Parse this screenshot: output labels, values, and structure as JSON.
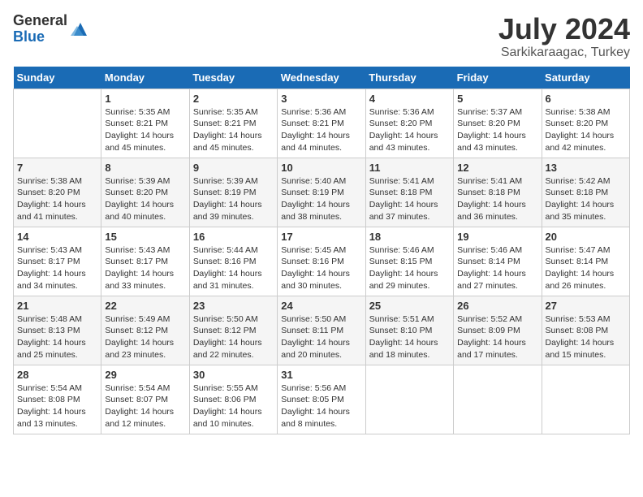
{
  "header": {
    "logo_general": "General",
    "logo_blue": "Blue",
    "month_year": "July 2024",
    "location": "Sarkikaraagac, Turkey"
  },
  "days_of_week": [
    "Sunday",
    "Monday",
    "Tuesday",
    "Wednesday",
    "Thursday",
    "Friday",
    "Saturday"
  ],
  "weeks": [
    [
      {
        "day": "",
        "info": ""
      },
      {
        "day": "1",
        "info": "Sunrise: 5:35 AM\nSunset: 8:21 PM\nDaylight: 14 hours\nand 45 minutes."
      },
      {
        "day": "2",
        "info": "Sunrise: 5:35 AM\nSunset: 8:21 PM\nDaylight: 14 hours\nand 45 minutes."
      },
      {
        "day": "3",
        "info": "Sunrise: 5:36 AM\nSunset: 8:21 PM\nDaylight: 14 hours\nand 44 minutes."
      },
      {
        "day": "4",
        "info": "Sunrise: 5:36 AM\nSunset: 8:20 PM\nDaylight: 14 hours\nand 43 minutes."
      },
      {
        "day": "5",
        "info": "Sunrise: 5:37 AM\nSunset: 8:20 PM\nDaylight: 14 hours\nand 43 minutes."
      },
      {
        "day": "6",
        "info": "Sunrise: 5:38 AM\nSunset: 8:20 PM\nDaylight: 14 hours\nand 42 minutes."
      }
    ],
    [
      {
        "day": "7",
        "info": "Sunrise: 5:38 AM\nSunset: 8:20 PM\nDaylight: 14 hours\nand 41 minutes."
      },
      {
        "day": "8",
        "info": "Sunrise: 5:39 AM\nSunset: 8:20 PM\nDaylight: 14 hours\nand 40 minutes."
      },
      {
        "day": "9",
        "info": "Sunrise: 5:39 AM\nSunset: 8:19 PM\nDaylight: 14 hours\nand 39 minutes."
      },
      {
        "day": "10",
        "info": "Sunrise: 5:40 AM\nSunset: 8:19 PM\nDaylight: 14 hours\nand 38 minutes."
      },
      {
        "day": "11",
        "info": "Sunrise: 5:41 AM\nSunset: 8:18 PM\nDaylight: 14 hours\nand 37 minutes."
      },
      {
        "day": "12",
        "info": "Sunrise: 5:41 AM\nSunset: 8:18 PM\nDaylight: 14 hours\nand 36 minutes."
      },
      {
        "day": "13",
        "info": "Sunrise: 5:42 AM\nSunset: 8:18 PM\nDaylight: 14 hours\nand 35 minutes."
      }
    ],
    [
      {
        "day": "14",
        "info": "Sunrise: 5:43 AM\nSunset: 8:17 PM\nDaylight: 14 hours\nand 34 minutes."
      },
      {
        "day": "15",
        "info": "Sunrise: 5:43 AM\nSunset: 8:17 PM\nDaylight: 14 hours\nand 33 minutes."
      },
      {
        "day": "16",
        "info": "Sunrise: 5:44 AM\nSunset: 8:16 PM\nDaylight: 14 hours\nand 31 minutes."
      },
      {
        "day": "17",
        "info": "Sunrise: 5:45 AM\nSunset: 8:16 PM\nDaylight: 14 hours\nand 30 minutes."
      },
      {
        "day": "18",
        "info": "Sunrise: 5:46 AM\nSunset: 8:15 PM\nDaylight: 14 hours\nand 29 minutes."
      },
      {
        "day": "19",
        "info": "Sunrise: 5:46 AM\nSunset: 8:14 PM\nDaylight: 14 hours\nand 27 minutes."
      },
      {
        "day": "20",
        "info": "Sunrise: 5:47 AM\nSunset: 8:14 PM\nDaylight: 14 hours\nand 26 minutes."
      }
    ],
    [
      {
        "day": "21",
        "info": "Sunrise: 5:48 AM\nSunset: 8:13 PM\nDaylight: 14 hours\nand 25 minutes."
      },
      {
        "day": "22",
        "info": "Sunrise: 5:49 AM\nSunset: 8:12 PM\nDaylight: 14 hours\nand 23 minutes."
      },
      {
        "day": "23",
        "info": "Sunrise: 5:50 AM\nSunset: 8:12 PM\nDaylight: 14 hours\nand 22 minutes."
      },
      {
        "day": "24",
        "info": "Sunrise: 5:50 AM\nSunset: 8:11 PM\nDaylight: 14 hours\nand 20 minutes."
      },
      {
        "day": "25",
        "info": "Sunrise: 5:51 AM\nSunset: 8:10 PM\nDaylight: 14 hours\nand 18 minutes."
      },
      {
        "day": "26",
        "info": "Sunrise: 5:52 AM\nSunset: 8:09 PM\nDaylight: 14 hours\nand 17 minutes."
      },
      {
        "day": "27",
        "info": "Sunrise: 5:53 AM\nSunset: 8:08 PM\nDaylight: 14 hours\nand 15 minutes."
      }
    ],
    [
      {
        "day": "28",
        "info": "Sunrise: 5:54 AM\nSunset: 8:08 PM\nDaylight: 14 hours\nand 13 minutes."
      },
      {
        "day": "29",
        "info": "Sunrise: 5:54 AM\nSunset: 8:07 PM\nDaylight: 14 hours\nand 12 minutes."
      },
      {
        "day": "30",
        "info": "Sunrise: 5:55 AM\nSunset: 8:06 PM\nDaylight: 14 hours\nand 10 minutes."
      },
      {
        "day": "31",
        "info": "Sunrise: 5:56 AM\nSunset: 8:05 PM\nDaylight: 14 hours\nand 8 minutes."
      },
      {
        "day": "",
        "info": ""
      },
      {
        "day": "",
        "info": ""
      },
      {
        "day": "",
        "info": ""
      }
    ]
  ]
}
